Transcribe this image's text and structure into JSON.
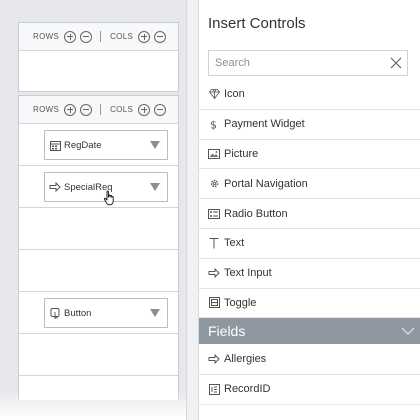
{
  "canvas": {
    "toolbar": {
      "rows_label": "ROWS",
      "cols_label": "COLS"
    },
    "controls": [
      {
        "label": "RegDate",
        "icon": "calendar-icon"
      },
      {
        "label": "SpecialReq",
        "icon": "text-input-icon"
      },
      {
        "label": "Button",
        "icon": "button-icon"
      }
    ]
  },
  "panel": {
    "title": "Insert Controls",
    "search": {
      "placeholder": "Search",
      "value": ""
    },
    "items": [
      {
        "label": "Icon",
        "icon": "diamond-icon"
      },
      {
        "label": "Payment Widget",
        "icon": "dollar-icon"
      },
      {
        "label": "Picture",
        "icon": "picture-icon"
      },
      {
        "label": "Portal Navigation",
        "icon": "gear-icon"
      },
      {
        "label": "Radio Button",
        "icon": "radio-button-icon"
      },
      {
        "label": "Text",
        "icon": "text-icon"
      },
      {
        "label": "Text Input",
        "icon": "text-input-icon"
      },
      {
        "label": "Toggle",
        "icon": "toggle-icon"
      }
    ],
    "fields": {
      "header": "Fields",
      "items": [
        {
          "label": "Allergies",
          "icon": "text-input-icon"
        },
        {
          "label": "RecordID",
          "icon": "id-field-icon"
        }
      ]
    }
  },
  "colors": {
    "fields_header_bg": "#8f98a1",
    "canvas_bg": "#e6e8eb"
  }
}
